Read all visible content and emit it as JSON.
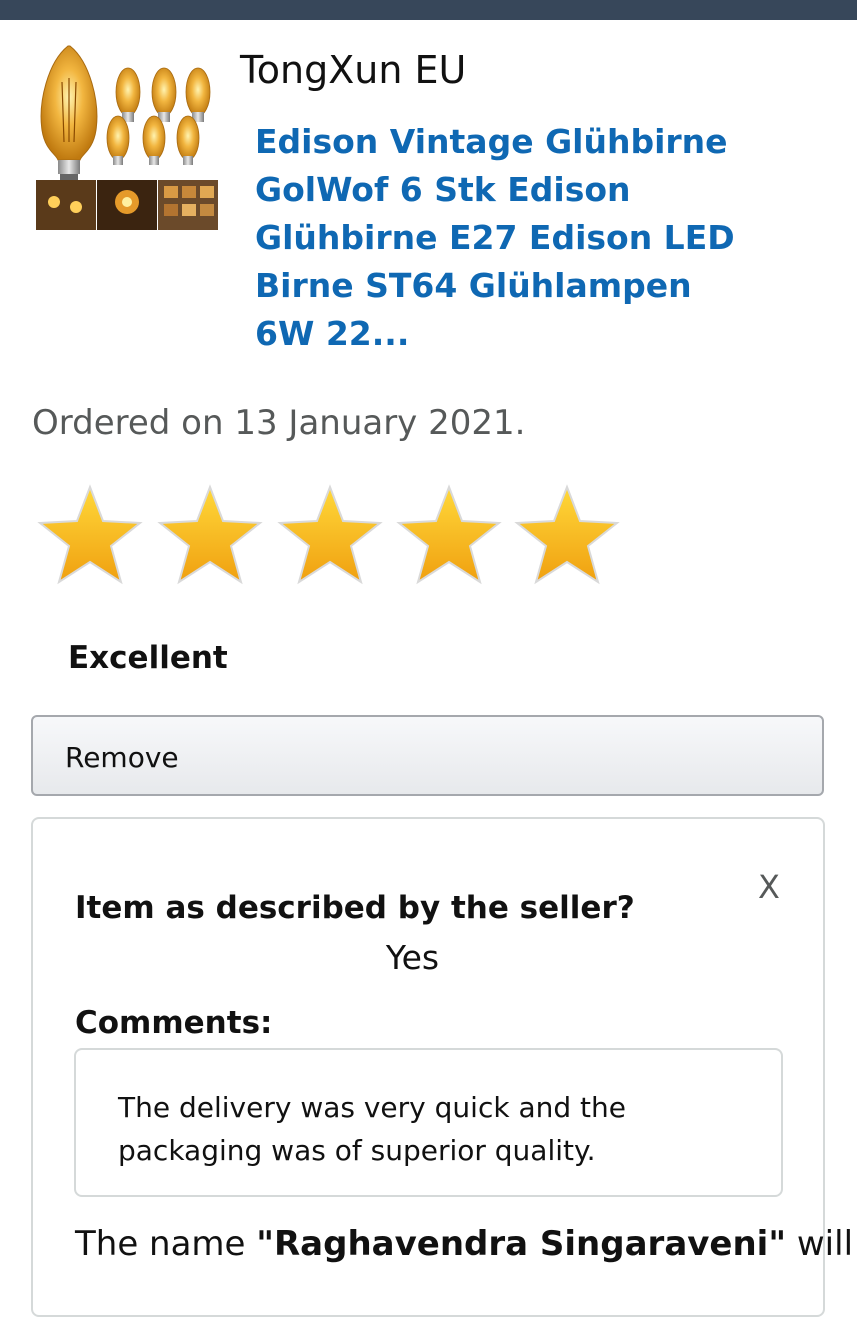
{
  "header": {
    "bar_color": "#37475a"
  },
  "product": {
    "image_icon": "edison-bulbs-thumbnail",
    "seller": "TongXun EU",
    "title": "Edison Vintage Glühbirne GolWof 6 Stk Edison Glühbirne E27 Edison LED Birne ST64 Glühlampen 6W 22...",
    "title_color": "#0f68b3"
  },
  "order": {
    "ordered_text": "Ordered on 13 January 2021."
  },
  "rating": {
    "stars": 5,
    "max_stars": 5,
    "star_icon": "star-icon",
    "star_color": "#f9b21b",
    "label": "Excellent"
  },
  "actions": {
    "remove_label": "Remove"
  },
  "feedback": {
    "close_label": "X",
    "question": "Item as described by the seller?",
    "answer": "Yes",
    "comments_label": "Comments:",
    "comment_text": "The delivery was very quick and the packaging was of superior quality.",
    "display_prefix": "The name ",
    "display_name": "\"Raghavendra Singaraveni\"",
    "display_suffix": " will"
  }
}
